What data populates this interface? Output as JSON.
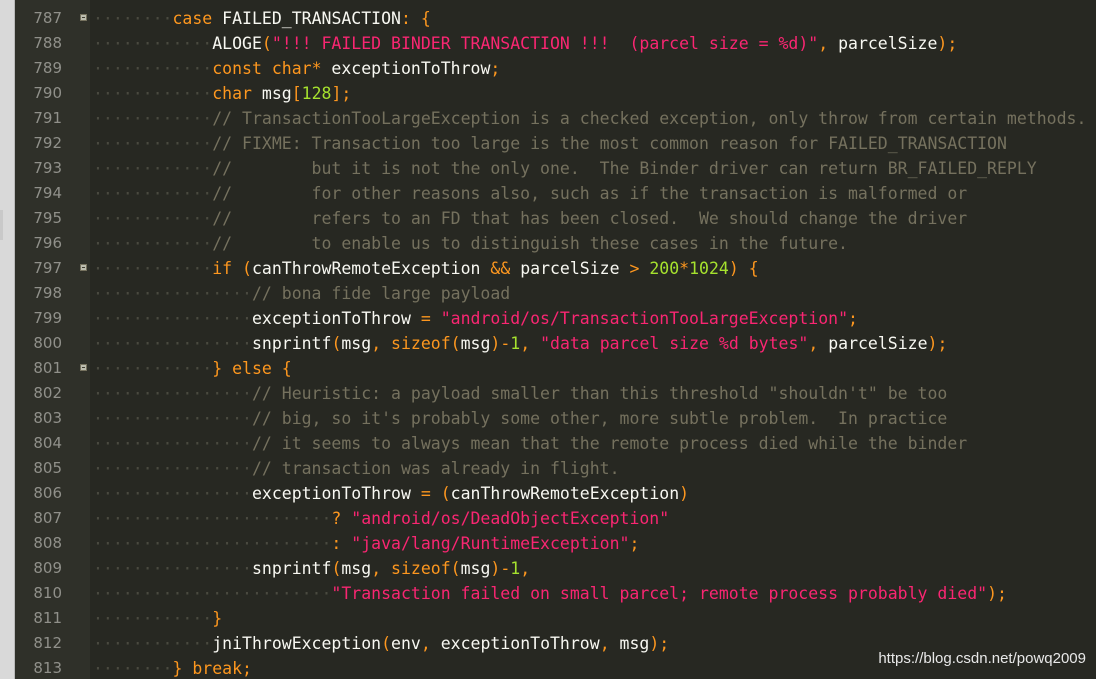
{
  "editor": {
    "lines": [
      {
        "num": "787",
        "fold": true,
        "indent": "········",
        "tokens": [
          [
            "case",
            "c-key"
          ],
          [
            " FAILED_TRANSACTION",
            "c-id"
          ],
          [
            ":",
            "c-punc"
          ],
          [
            " {",
            "c-punc"
          ]
        ]
      },
      {
        "num": "788",
        "fold": false,
        "indent": "············",
        "tokens": [
          [
            "ALOGE",
            "c-id"
          ],
          [
            "(",
            "c-punc"
          ],
          [
            "\"!!! FAILED BINDER TRANSACTION !!!  (parcel size = %d)\"",
            "c-str"
          ],
          [
            ",",
            "c-punc"
          ],
          [
            " parcelSize",
            "c-id"
          ],
          [
            ");",
            "c-punc"
          ]
        ]
      },
      {
        "num": "789",
        "fold": false,
        "indent": "············",
        "tokens": [
          [
            "const",
            "c-key"
          ],
          [
            " char",
            "c-key"
          ],
          [
            "*",
            "c-punc"
          ],
          [
            " exceptionToThrow",
            "c-id"
          ],
          [
            ";",
            "c-punc"
          ]
        ]
      },
      {
        "num": "790",
        "fold": false,
        "indent": "············",
        "tokens": [
          [
            "char",
            "c-key"
          ],
          [
            " msg",
            "c-id"
          ],
          [
            "[",
            "c-punc"
          ],
          [
            "128",
            "c-grn"
          ],
          [
            "];",
            "c-punc"
          ]
        ]
      },
      {
        "num": "791",
        "fold": false,
        "indent": "············",
        "tokens": [
          [
            "// TransactionTooLargeException is a checked exception, only throw from certain methods.",
            "c-cmt"
          ]
        ]
      },
      {
        "num": "792",
        "fold": false,
        "indent": "············",
        "tokens": [
          [
            "// FIXME: Transaction too large is the most common reason for FAILED_TRANSACTION",
            "c-cmt"
          ]
        ]
      },
      {
        "num": "793",
        "fold": false,
        "indent": "············",
        "tokens": [
          [
            "//        but it is not the only one.  The Binder driver can return BR_FAILED_REPLY",
            "c-cmt"
          ]
        ]
      },
      {
        "num": "794",
        "fold": false,
        "indent": "············",
        "tokens": [
          [
            "//        for other reasons also, such as if the transaction is malformed or",
            "c-cmt"
          ]
        ]
      },
      {
        "num": "795",
        "fold": false,
        "indent": "············",
        "tokens": [
          [
            "//        refers to an FD that has been closed.  We should change the driver",
            "c-cmt"
          ]
        ]
      },
      {
        "num": "796",
        "fold": false,
        "indent": "············",
        "tokens": [
          [
            "//        to enable us to distinguish these cases in the future.",
            "c-cmt"
          ]
        ]
      },
      {
        "num": "797",
        "fold": true,
        "indent": "············",
        "tokens": [
          [
            "if",
            "c-key"
          ],
          [
            " (",
            "c-punc"
          ],
          [
            "canThrowRemoteException",
            "c-id"
          ],
          [
            " &&",
            "c-punc"
          ],
          [
            " parcelSize",
            "c-id"
          ],
          [
            " >",
            "c-punc"
          ],
          [
            " 200",
            "c-grn"
          ],
          [
            "*",
            "c-punc"
          ],
          [
            "1024",
            "c-grn"
          ],
          [
            ")",
            "c-punc"
          ],
          [
            " {",
            "c-punc"
          ]
        ]
      },
      {
        "num": "798",
        "fold": false,
        "indent": "················",
        "tokens": [
          [
            "// bona fide large payload",
            "c-cmt"
          ]
        ]
      },
      {
        "num": "799",
        "fold": false,
        "indent": "················",
        "tokens": [
          [
            "exceptionToThrow",
            "c-id"
          ],
          [
            " =",
            "c-punc"
          ],
          [
            " \"android/os/TransactionTooLargeException\"",
            "c-str"
          ],
          [
            ";",
            "c-punc"
          ]
        ]
      },
      {
        "num": "800",
        "fold": false,
        "indent": "················",
        "tokens": [
          [
            "snprintf",
            "c-id"
          ],
          [
            "(",
            "c-punc"
          ],
          [
            "msg",
            "c-id"
          ],
          [
            ",",
            "c-punc"
          ],
          [
            " sizeof",
            "c-key"
          ],
          [
            "(",
            "c-punc"
          ],
          [
            "msg",
            "c-id"
          ],
          [
            ")-",
            "c-punc"
          ],
          [
            "1",
            "c-grn"
          ],
          [
            ",",
            "c-punc"
          ],
          [
            " \"data parcel size %d bytes\"",
            "c-str"
          ],
          [
            ",",
            "c-punc"
          ],
          [
            " parcelSize",
            "c-id"
          ],
          [
            ");",
            "c-punc"
          ]
        ]
      },
      {
        "num": "801",
        "fold": true,
        "indent": "············",
        "tokens": [
          [
            "}",
            "c-punc"
          ],
          [
            " else",
            "c-key"
          ],
          [
            " {",
            "c-punc"
          ]
        ]
      },
      {
        "num": "802",
        "fold": false,
        "indent": "················",
        "tokens": [
          [
            "// Heuristic: a payload smaller than this threshold \"shouldn't\" be too",
            "c-cmt"
          ]
        ]
      },
      {
        "num": "803",
        "fold": false,
        "indent": "················",
        "tokens": [
          [
            "// big, so it's probably some other, more subtle problem.  In practice",
            "c-cmt"
          ]
        ]
      },
      {
        "num": "804",
        "fold": false,
        "indent": "················",
        "tokens": [
          [
            "// it seems to always mean that the remote process died while the binder",
            "c-cmt"
          ]
        ]
      },
      {
        "num": "805",
        "fold": false,
        "indent": "················",
        "tokens": [
          [
            "// transaction was already in flight.",
            "c-cmt"
          ]
        ]
      },
      {
        "num": "806",
        "fold": false,
        "indent": "················",
        "tokens": [
          [
            "exceptionToThrow",
            "c-id"
          ],
          [
            " =",
            "c-punc"
          ],
          [
            " (",
            "c-punc"
          ],
          [
            "canThrowRemoteException",
            "c-id"
          ],
          [
            ")",
            "c-punc"
          ]
        ]
      },
      {
        "num": "807",
        "fold": false,
        "indent": "························",
        "tokens": [
          [
            "?",
            "c-punc"
          ],
          [
            " \"android/os/DeadObjectException\"",
            "c-str"
          ]
        ]
      },
      {
        "num": "808",
        "fold": false,
        "indent": "························",
        "tokens": [
          [
            ":",
            "c-punc"
          ],
          [
            " \"java/lang/RuntimeException\"",
            "c-str"
          ],
          [
            ";",
            "c-punc"
          ]
        ]
      },
      {
        "num": "809",
        "fold": false,
        "indent": "················",
        "tokens": [
          [
            "snprintf",
            "c-id"
          ],
          [
            "(",
            "c-punc"
          ],
          [
            "msg",
            "c-id"
          ],
          [
            ",",
            "c-punc"
          ],
          [
            " sizeof",
            "c-key"
          ],
          [
            "(",
            "c-punc"
          ],
          [
            "msg",
            "c-id"
          ],
          [
            ")-",
            "c-punc"
          ],
          [
            "1",
            "c-grn"
          ],
          [
            ",",
            "c-punc"
          ]
        ]
      },
      {
        "num": "810",
        "fold": false,
        "indent": "························",
        "tokens": [
          [
            "\"Transaction failed on small parcel; remote process probably died\"",
            "c-str"
          ],
          [
            ");",
            "c-punc"
          ]
        ]
      },
      {
        "num": "811",
        "fold": false,
        "indent": "············",
        "tokens": [
          [
            "}",
            "c-punc"
          ]
        ]
      },
      {
        "num": "812",
        "fold": false,
        "indent": "············",
        "tokens": [
          [
            "jniThrowException",
            "c-id"
          ],
          [
            "(",
            "c-punc"
          ],
          [
            "env",
            "c-id"
          ],
          [
            ",",
            "c-punc"
          ],
          [
            " exceptionToThrow",
            "c-id"
          ],
          [
            ",",
            "c-punc"
          ],
          [
            " msg",
            "c-id"
          ],
          [
            ");",
            "c-punc"
          ]
        ]
      },
      {
        "num": "813",
        "fold": false,
        "indent": "········",
        "tokens": [
          [
            "}",
            "c-punc"
          ],
          [
            " break",
            "c-key"
          ],
          [
            ";",
            "c-punc"
          ]
        ]
      }
    ]
  },
  "watermark": "https://blog.csdn.net/powq2009",
  "colors": {
    "background": "#272822",
    "gutter": "#2f3029",
    "line_number": "#90908a",
    "keyword": "#fd971f",
    "string": "#f92672",
    "number": "#a6e22e",
    "comment": "#75715e",
    "identifier": "#f8f8f2"
  }
}
